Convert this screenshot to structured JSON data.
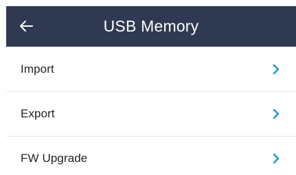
{
  "header": {
    "title": "USB Memory",
    "back_icon": "arrow-left-icon",
    "background": "#2f3a52",
    "text_color": "#ffffff"
  },
  "menu": {
    "items": [
      {
        "label": "Import",
        "icon": "chevron-right-icon"
      },
      {
        "label": "Export",
        "icon": "chevron-right-icon"
      },
      {
        "label": "FW Upgrade",
        "icon": "chevron-right-icon"
      }
    ],
    "chevron_color": "#1a9fc9"
  }
}
